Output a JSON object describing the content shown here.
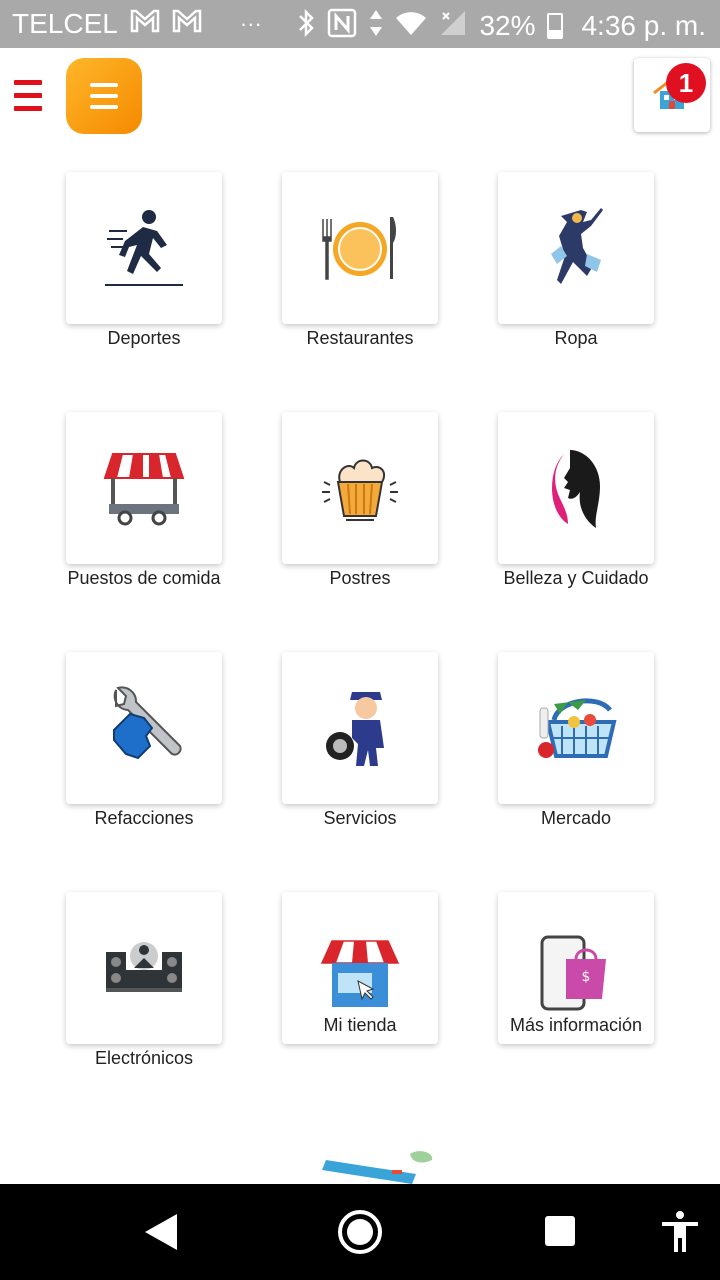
{
  "status_bar": {
    "carrier": "TELCEL",
    "battery": "32%",
    "time": "4:36 p. m.",
    "icons": [
      "gmail-icon",
      "gmail-icon",
      "more-dots-icon",
      "bluetooth-icon",
      "nfc-icon",
      "data-arrows-icon",
      "wifi-icon",
      "signal-icon",
      "battery-icon"
    ]
  },
  "app_bar": {
    "left_menu_icon": "hamburger-icon",
    "menu_button_icon": "hamburger-icon",
    "store_icon": "store-house-icon",
    "notification_count": "1",
    "colors": {
      "red": "#e0101b",
      "orange": "#f79a10",
      "badge": "#e01020"
    }
  },
  "categories": [
    {
      "label": "Deportes",
      "icon": "runner-icon"
    },
    {
      "label": "Restaurantes",
      "icon": "plate-cutlery-icon"
    },
    {
      "label": "Ropa",
      "icon": "fashion-figure-icon"
    },
    {
      "label": "Puestos de comida",
      "icon": "food-stall-icon"
    },
    {
      "label": "Postres",
      "icon": "cupcake-icon"
    },
    {
      "label": "Belleza y Cuidado",
      "icon": "woman-profile-icon"
    },
    {
      "label": "Refacciones",
      "icon": "wrench-hand-icon"
    },
    {
      "label": "Servicios",
      "icon": "mechanic-tire-icon"
    },
    {
      "label": "Mercado",
      "icon": "grocery-basket-icon"
    },
    {
      "label": "Electrónicos",
      "icon": "dj-booth-icon"
    },
    {
      "label": "Mi tienda",
      "icon": "shop-awning-icon"
    },
    {
      "label": "Más información",
      "icon": "phone-shopping-bag-icon"
    }
  ],
  "nav_bar": {
    "icons": [
      "back-icon",
      "home-icon",
      "recents-icon",
      "accessibility-icon"
    ]
  }
}
